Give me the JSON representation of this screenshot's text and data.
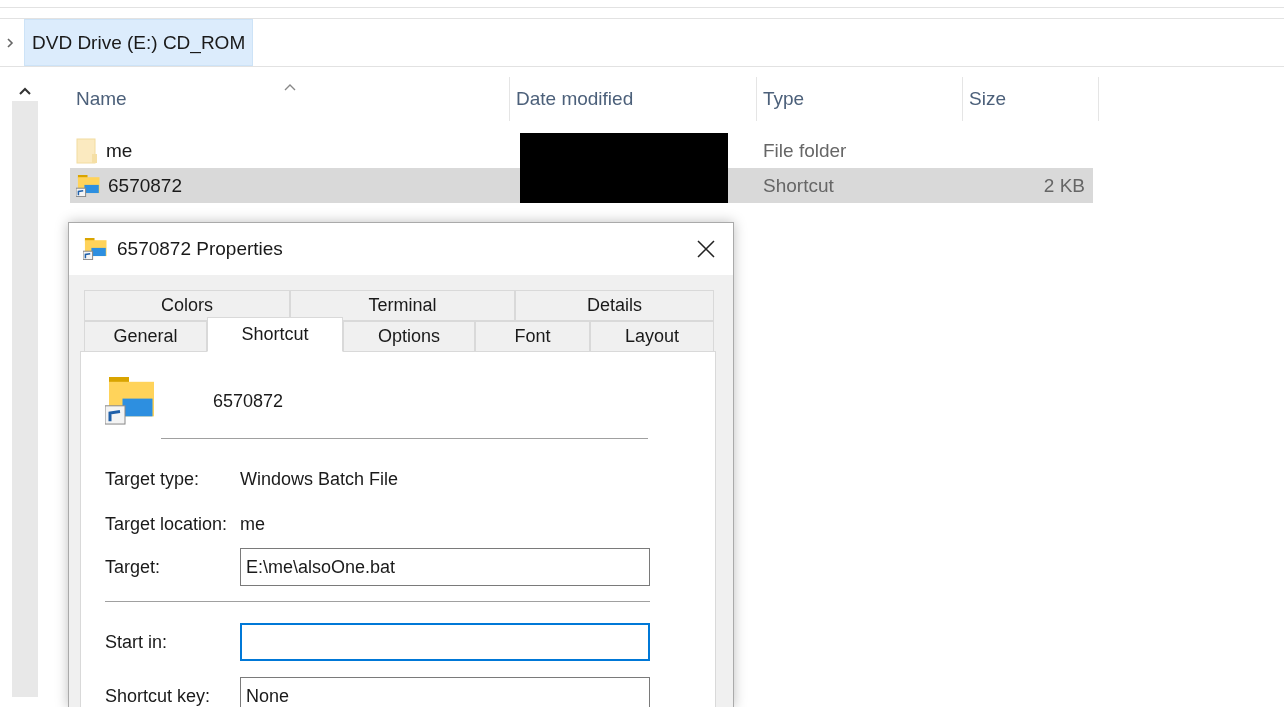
{
  "breadcrumb": {
    "items": [
      {
        "label": "DVD Drive (E:) CD_ROM",
        "selected": true
      }
    ]
  },
  "file_list": {
    "columns": [
      {
        "label": "Name",
        "sorted": true
      },
      {
        "label": "Date modified",
        "sorted": false
      },
      {
        "label": "Type",
        "sorted": false
      },
      {
        "label": "Size",
        "sorted": false
      }
    ],
    "rows": [
      {
        "name": "me",
        "kind": "folder",
        "date_hidden": true,
        "type": "File folder",
        "selected": false
      },
      {
        "name": "6570872",
        "kind": "shortcut",
        "date_hidden": true,
        "type": "Shortcut",
        "size": "2 KB",
        "selected": true
      }
    ]
  },
  "dialog": {
    "title": "6570872 Properties",
    "tab_rows": [
      [
        {
          "label": "Colors",
          "selected": false
        },
        {
          "label": "Terminal",
          "selected": false
        },
        {
          "label": "Details",
          "selected": false
        }
      ],
      [
        {
          "label": "General",
          "selected": false
        },
        {
          "label": "Shortcut",
          "selected": true
        },
        {
          "label": "Options",
          "selected": false
        },
        {
          "label": "Font",
          "selected": false
        },
        {
          "label": "Layout",
          "selected": false
        }
      ]
    ],
    "file_name": "6570872",
    "fields": [
      {
        "kind": "text",
        "label": "Target type:",
        "value": "Windows Batch File"
      },
      {
        "kind": "text",
        "label": "Target location:",
        "value": "me"
      },
      {
        "kind": "input",
        "label": "Target:",
        "value": "E:\\me\\alsoOne.bat",
        "focused": false
      },
      {
        "kind": "divider"
      },
      {
        "kind": "input",
        "label": "Start in:",
        "focused": true
      },
      {
        "kind": "input",
        "label": "Shortcut key:",
        "value": "None",
        "focused": false
      }
    ]
  }
}
